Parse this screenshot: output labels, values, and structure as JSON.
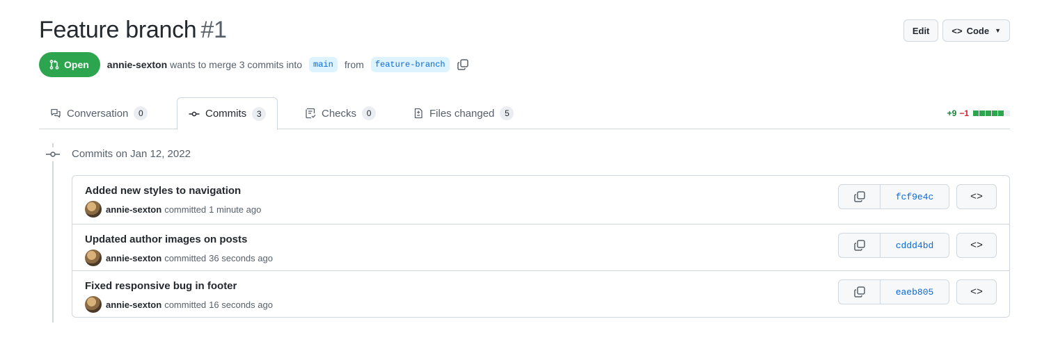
{
  "pr": {
    "title": "Feature branch",
    "number": "#1",
    "state": "Open",
    "author": "annie-sexton",
    "merge_text": "wants to merge 3 commits into",
    "base_branch": "main",
    "from_text": "from",
    "head_branch": "feature-branch"
  },
  "header_actions": {
    "edit_label": "Edit",
    "code_label": "Code"
  },
  "tabs": [
    {
      "label": "Conversation",
      "count": "0",
      "icon": "comment-discussion-icon"
    },
    {
      "label": "Commits",
      "count": "3",
      "icon": "git-commit-icon",
      "active": true
    },
    {
      "label": "Checks",
      "count": "0",
      "icon": "checklist-icon"
    },
    {
      "label": "Files changed",
      "count": "5",
      "icon": "file-diff-icon"
    }
  ],
  "diffstat": {
    "additions": "+9",
    "deletions": "−1",
    "blocks": [
      "added",
      "added",
      "added",
      "added",
      "added",
      "neutral"
    ],
    "colors": {
      "added": "#2da44e",
      "deleted": "#cf222e",
      "neutral": "#eaeef2"
    }
  },
  "commits_group": {
    "date_label": "Commits on Jan 12, 2022"
  },
  "commits": [
    {
      "message": "Added new styles to navigation",
      "author": "annie-sexton",
      "action": "committed",
      "time": "1 minute ago",
      "sha": "fcf9e4c"
    },
    {
      "message": "Updated author images on posts",
      "author": "annie-sexton",
      "action": "committed",
      "time": "36 seconds ago",
      "sha": "cddd4bd"
    },
    {
      "message": "Fixed responsive bug in footer",
      "author": "annie-sexton",
      "action": "committed",
      "time": "16 seconds ago",
      "sha": "eaeb805"
    }
  ],
  "colors": {
    "open_green": "#2da44e",
    "link_blue": "#0969da",
    "branch_bg": "#ddf4ff",
    "border": "#d0d7de"
  }
}
